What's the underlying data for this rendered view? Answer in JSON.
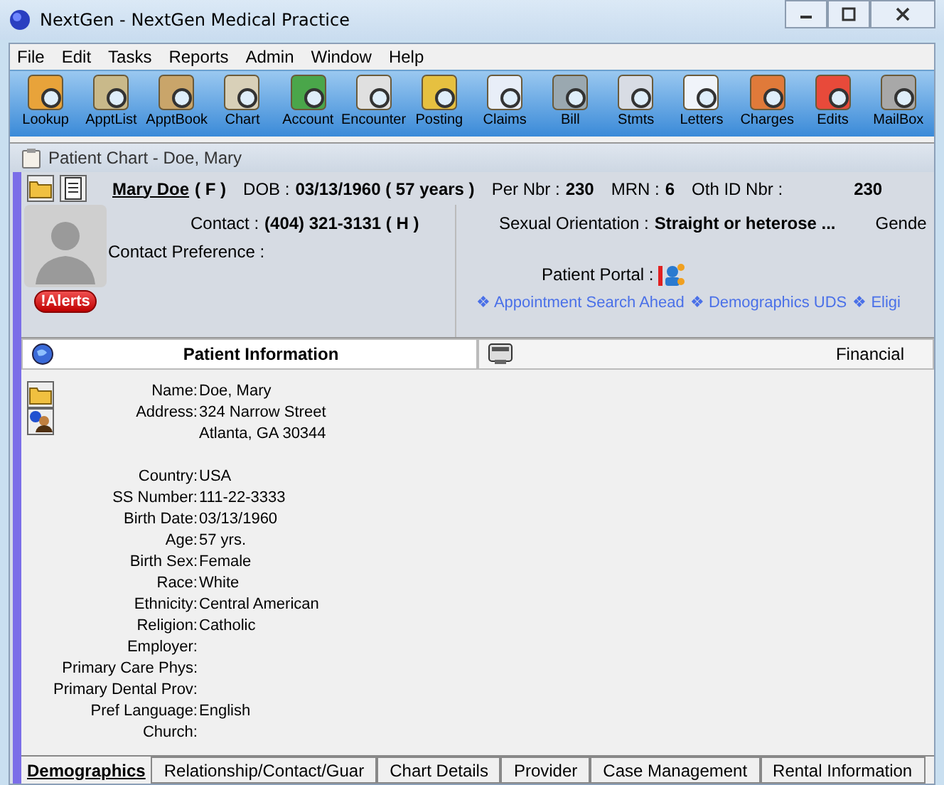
{
  "window": {
    "title": "NextGen - NextGen Medical Practice"
  },
  "menu": [
    "File",
    "Edit",
    "Tasks",
    "Reports",
    "Admin",
    "Window",
    "Help"
  ],
  "toolbar": [
    {
      "label": "Lookup"
    },
    {
      "label": "ApptList"
    },
    {
      "label": "ApptBook"
    },
    {
      "label": "Chart"
    },
    {
      "label": "Account"
    },
    {
      "label": "Encounter"
    },
    {
      "label": "Posting"
    },
    {
      "label": "Claims"
    },
    {
      "label": "Bill"
    },
    {
      "label": "Stmts"
    },
    {
      "label": "Letters"
    },
    {
      "label": "Charges"
    },
    {
      "label": "Edits"
    },
    {
      "label": "MailBox"
    }
  ],
  "chart_title": "Patient Chart - Doe, Mary",
  "header": {
    "name": "Mary Doe",
    "sex": "( F )",
    "items": [
      {
        "label": "DOB :",
        "value": "03/13/1960 ( 57 years )"
      },
      {
        "label": "Per Nbr :",
        "value": "230"
      },
      {
        "label": "MRN :",
        "value": "6"
      },
      {
        "label": "Oth ID Nbr :",
        "value": "230"
      }
    ],
    "contact_label": "Contact :",
    "contact_value": "(404) 321-3131 ( H )",
    "orientation_label": "Sexual Orientation :",
    "orientation_value": "Straight or heterose ...",
    "gender_label": "Gende",
    "preference_label": "Contact Preference :",
    "alerts": "!Alerts",
    "portal_label": "Patient Portal :",
    "links": [
      "❖ Appointment Search Ahead",
      "❖ Demographics UDS",
      "❖ Eligi"
    ]
  },
  "tabs": [
    {
      "label": "Patient Information",
      "selected": true
    },
    {
      "label": "Financial",
      "selected": false
    }
  ],
  "fields": [
    {
      "label": "Name:",
      "value": [
        "Doe, Mary"
      ]
    },
    {
      "label": "Address:",
      "value": [
        "324 Narrow Street",
        "Atlanta, GA 30344"
      ]
    },
    {
      "label": "Country:",
      "value": [
        "USA"
      ],
      "gap": true
    },
    {
      "label": "SS Number:",
      "value": [
        "111-22-3333"
      ]
    },
    {
      "label": "Birth Date:",
      "value": [
        "03/13/1960"
      ]
    },
    {
      "label": "Age:",
      "value": [
        "57 yrs."
      ]
    },
    {
      "label": "Birth Sex:",
      "value": [
        "Female"
      ]
    },
    {
      "label": "Race:",
      "value": [
        "White"
      ]
    },
    {
      "label": "Ethnicity:",
      "value": [
        "Central American"
      ]
    },
    {
      "label": "Religion:",
      "value": [
        "Catholic"
      ]
    },
    {
      "label": "Employer:"
    },
    {
      "label": "Primary Care Phys:"
    },
    {
      "label": "Primary Dental Prov:"
    },
    {
      "label": "Pref Language:",
      "value": [
        "English"
      ]
    },
    {
      "label": "Church:"
    }
  ],
  "bottom_tabs": [
    {
      "label": "Demographics",
      "selected": true
    },
    {
      "label": "Relationship/Contact/Guar",
      "selected": false
    },
    {
      "label": "Chart Details",
      "selected": false
    },
    {
      "label": "Provider",
      "selected": false
    },
    {
      "label": "Case Management",
      "selected": false
    },
    {
      "label": "Rental Information",
      "selected": false
    }
  ]
}
